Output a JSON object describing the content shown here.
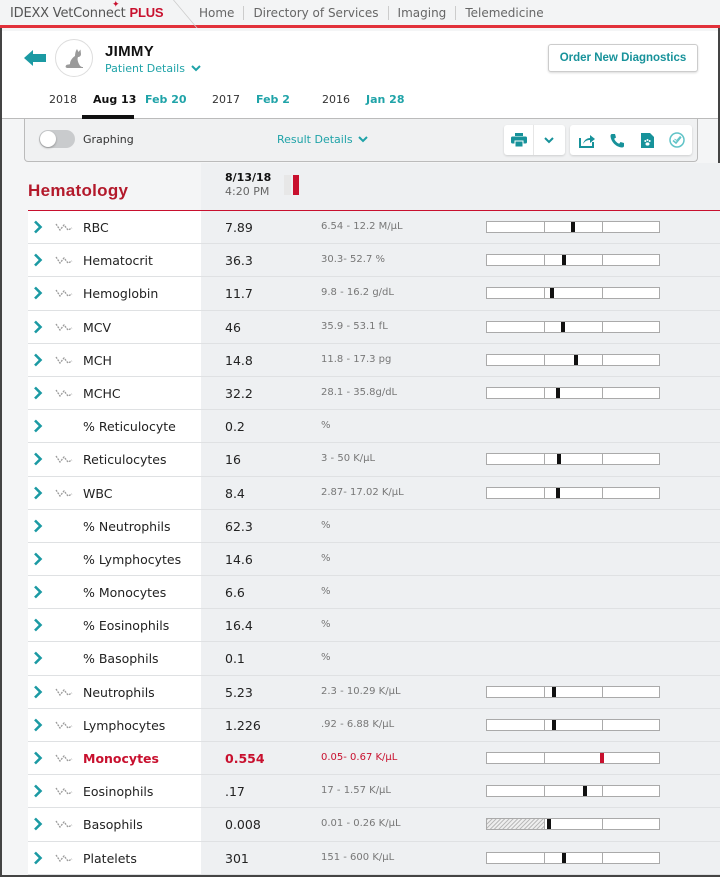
{
  "topnav": {
    "brand_prefix": "IDEXX VetConnect",
    "brand_suffix": "PLUS",
    "links": [
      "Home",
      "Directory of Services",
      "Imaging",
      "Telemedicine"
    ]
  },
  "patient": {
    "name": "JIMMY",
    "details_label": "Patient Details",
    "order_button": "Order New Diagnostics"
  },
  "date_tabs": [
    {
      "label": "2018",
      "type": "year"
    },
    {
      "label": "Aug 13",
      "type": "active"
    },
    {
      "label": "Feb 20",
      "type": "link"
    },
    {
      "label": "2017",
      "type": "year"
    },
    {
      "label": "Feb 2",
      "type": "link"
    },
    {
      "label": "2016",
      "type": "year"
    },
    {
      "label": "Jan 28",
      "type": "link"
    }
  ],
  "toolbar": {
    "graphing_label": "Graphing",
    "graphing_on": false,
    "result_details_label": "Result Details",
    "icons": [
      "print-icon",
      "chevron-down-icon",
      "share-icon",
      "phone-icon",
      "paw-document-icon",
      "check-circle-icon"
    ]
  },
  "section": {
    "title": "Hematology",
    "date": "8/13/18",
    "time": "4:20 PM"
  },
  "colors": {
    "accent": "#1fa3a8",
    "brand_red": "#c8102e",
    "abnormal": "#c8102e"
  },
  "results": [
    {
      "name": "RBC",
      "value": "7.89",
      "range": "6.54 - 12.2 M/µL",
      "trend": true,
      "bar": true,
      "marker": 0.5
    },
    {
      "name": "Hematocrit",
      "value": "36.3",
      "range": "30.3- 52.7 %",
      "trend": true,
      "bar": true,
      "marker": 0.45
    },
    {
      "name": "Hemoglobin",
      "value": "11.7",
      "range": "9.8 - 16.2 g/dL",
      "trend": true,
      "bar": true,
      "marker": 0.38
    },
    {
      "name": "MCV",
      "value": "46",
      "range": "35.9 - 53.1 fL",
      "trend": true,
      "bar": true,
      "marker": 0.44
    },
    {
      "name": "MCH",
      "value": "14.8",
      "range": "11.8 - 17.3 pg",
      "trend": true,
      "bar": true,
      "marker": 0.52
    },
    {
      "name": "MCHC",
      "value": "32.2",
      "range": "28.1 - 35.8g/dL",
      "trend": true,
      "bar": true,
      "marker": 0.41
    },
    {
      "name": "% Reticulocyte",
      "value": "0.2",
      "range": "%",
      "trend": false,
      "bar": false
    },
    {
      "name": "Reticulocytes",
      "value": "16",
      "range": "3 - 50 K/µL",
      "trend": true,
      "bar": true,
      "marker": 0.42
    },
    {
      "name": "WBC",
      "value": "8.4",
      "range": "2.87- 17.02 K/µL",
      "trend": true,
      "bar": true,
      "marker": 0.41
    },
    {
      "name": "% Neutrophils",
      "value": "62.3",
      "range": "%",
      "trend": false,
      "bar": false
    },
    {
      "name": "% Lymphocytes",
      "value": "14.6",
      "range": "%",
      "trend": false,
      "bar": false
    },
    {
      "name": "% Monocytes",
      "value": "6.6",
      "range": "%",
      "trend": false,
      "bar": false
    },
    {
      "name": "% Eosinophils",
      "value": "16.4",
      "range": "%",
      "trend": false,
      "bar": false
    },
    {
      "name": "% Basophils",
      "value": "0.1",
      "range": "%",
      "trend": false,
      "bar": false
    },
    {
      "name": "Neutrophils",
      "value": "5.23",
      "range": "2.3 - 10.29 K/µL",
      "trend": true,
      "bar": true,
      "marker": 0.39
    },
    {
      "name": "Lymphocytes",
      "value": "1.226",
      "range": ".92 - 6.88 K/µL",
      "trend": true,
      "bar": true,
      "marker": 0.39
    },
    {
      "name": "Monocytes",
      "value": "0.554",
      "range": "0.05- 0.67 K/µL",
      "trend": true,
      "bar": true,
      "marker": 0.67,
      "abnormal": true
    },
    {
      "name": "Eosinophils",
      "value": ".17",
      "range": "17 - 1.57 K/µL",
      "trend": true,
      "bar": true,
      "marker": 0.57
    },
    {
      "name": "Basophils",
      "value": "0.008",
      "range": "0.01 - 0.26 K/µL",
      "trend": true,
      "bar": true,
      "marker": 0.36,
      "low_hatch": true
    },
    {
      "name": "Platelets",
      "value": "301",
      "range": "151 - 600 K/µL",
      "trend": true,
      "bar": true,
      "marker": 0.45
    }
  ]
}
